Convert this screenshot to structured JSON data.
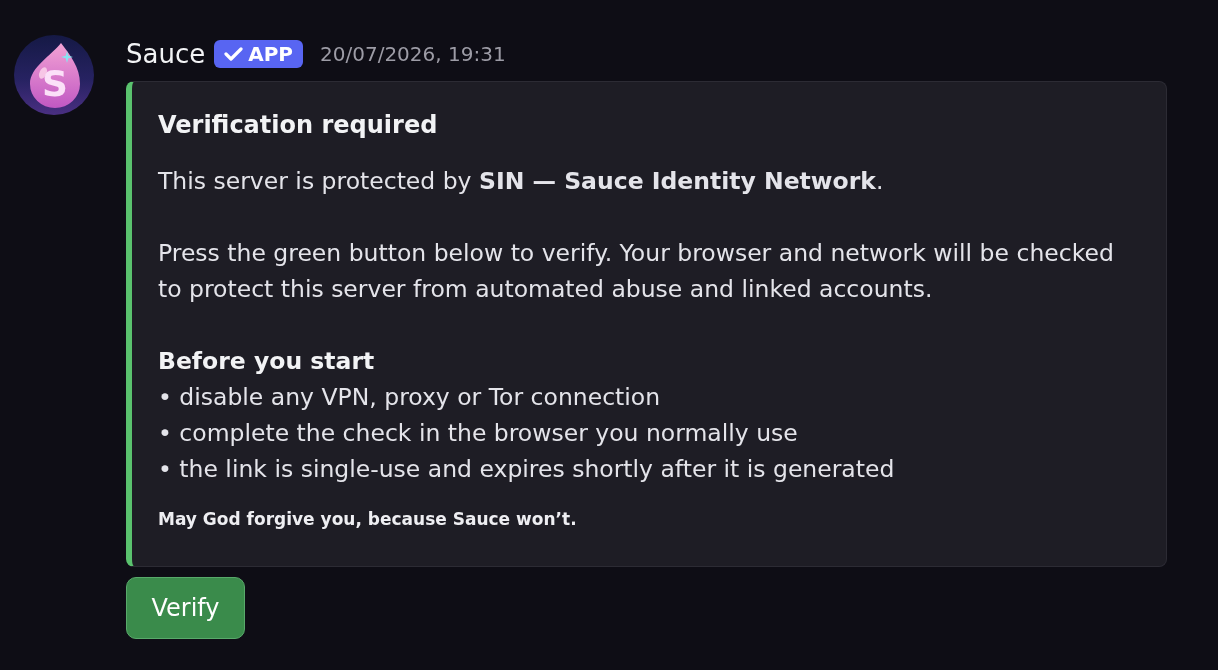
{
  "message": {
    "author": {
      "name": "Sauce",
      "avatar_letter": "S",
      "badge": {
        "label": "APP",
        "verified": true
      }
    },
    "timestamp": "20/07/2026, 19:31",
    "embed": {
      "title": "Verification required",
      "paragraphs": [
        "This server is protected by **SIN — Sauce Identity Network**.",
        "Press the green button below to verify. Your browser and network will be checked to protect this server from automated abuse and linked accounts."
      ],
      "list_heading": "Before you start",
      "list_items": [
        "• disable any VPN, proxy or Tor connection",
        "• complete the check in the browser you normally use",
        "• the link is single-use and expires shortly after it is generated"
      ],
      "footer": "May God forgive you, because Sauce won’t."
    },
    "buttons": [
      {
        "label": "Verify"
      }
    ]
  }
}
